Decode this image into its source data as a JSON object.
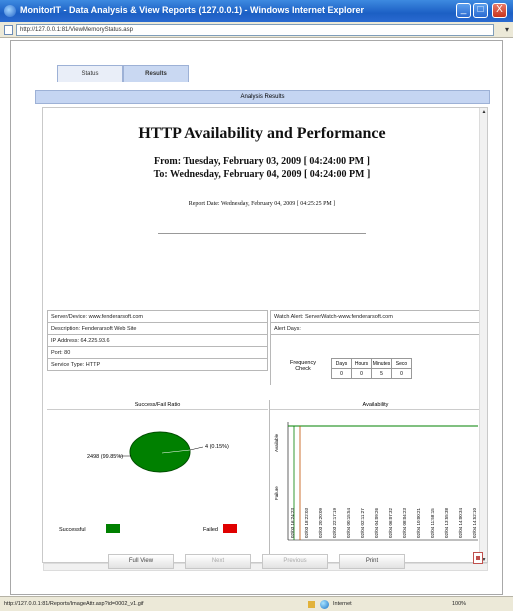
{
  "window": {
    "title": "MonitorIT - Data Analysis & View Reports (127.0.0.1) - Windows Internet Explorer",
    "url": "http://127.0.0.1:81/ViewMemoryStatus.asp",
    "buttons": {
      "minimize": "_",
      "maximize": "□",
      "close": "X"
    }
  },
  "tabs": [
    {
      "label": "Status",
      "active": false
    },
    {
      "label": "Results",
      "active": true
    }
  ],
  "results_header": "Analysis Results",
  "report": {
    "title": "HTTP Availability and Performance",
    "from": "From: Tuesday, February 03, 2009 [ 04:24:00 PM ]",
    "to": "To: Wednesday, February 04, 2009 [ 04:24:00 PM ]",
    "report_date": "Report Date: Wednesday, February 04, 2009 [ 04:25:25 PM ]"
  },
  "left_table": [
    "Server/Device: www.fenderarsoft.com",
    "Description: Fenderarsoft Web Site",
    "IP Address: 64.225.93.6",
    "Port: 80",
    "Service Type: HTTP"
  ],
  "right_table": [
    "Watch Alert: ServerWatch-www.fenderarsoft.com",
    "Alert Days:"
  ],
  "frequency": {
    "label": "Frequency Check",
    "headers": [
      "Days",
      "Hours",
      "Minutes",
      "Seco"
    ],
    "values": [
      "0",
      "0",
      "5",
      "0"
    ]
  },
  "pie_panel": {
    "title": "Success/Fail Ratio",
    "success_label": "2498 (99.85%)",
    "fail_label": "4 (0.15%)",
    "legend_success": "Successful",
    "legend_failed": "Failed",
    "colors": {
      "success": "#008000",
      "failed": "#e00000"
    }
  },
  "chart_data": {
    "type": "line",
    "title": "Availability",
    "y_labels": [
      "Available",
      "Failure"
    ],
    "x": [
      "02/03 16:24:23",
      "02/03 18:22:03",
      "02/03 20:20:09",
      "02/03 22:17:19",
      "02/04 00:15:54",
      "02/04 02:11:27",
      "02/04 04:09:26",
      "02/04 06:07:32",
      "02/04 08:04:23",
      "02/04 10:00:21",
      "02/04 11:58:15",
      "02/04 13:55:38",
      "02/04 14:00:34",
      "02/04 14:52:10"
    ],
    "status_color": "#008000",
    "failure_color": "#c05000"
  },
  "bottom_buttons": [
    {
      "label": "Full View",
      "enabled": true
    },
    {
      "label": "Next",
      "enabled": false
    },
    {
      "label": "Previous",
      "enabled": false
    },
    {
      "label": "Print",
      "enabled": true
    }
  ],
  "statusbar": {
    "url": "http://127.0.0.1:81/Reports/ImageAttr.asp?id=0002_v1.gif",
    "zone": "Internet",
    "zoom": "100%"
  }
}
